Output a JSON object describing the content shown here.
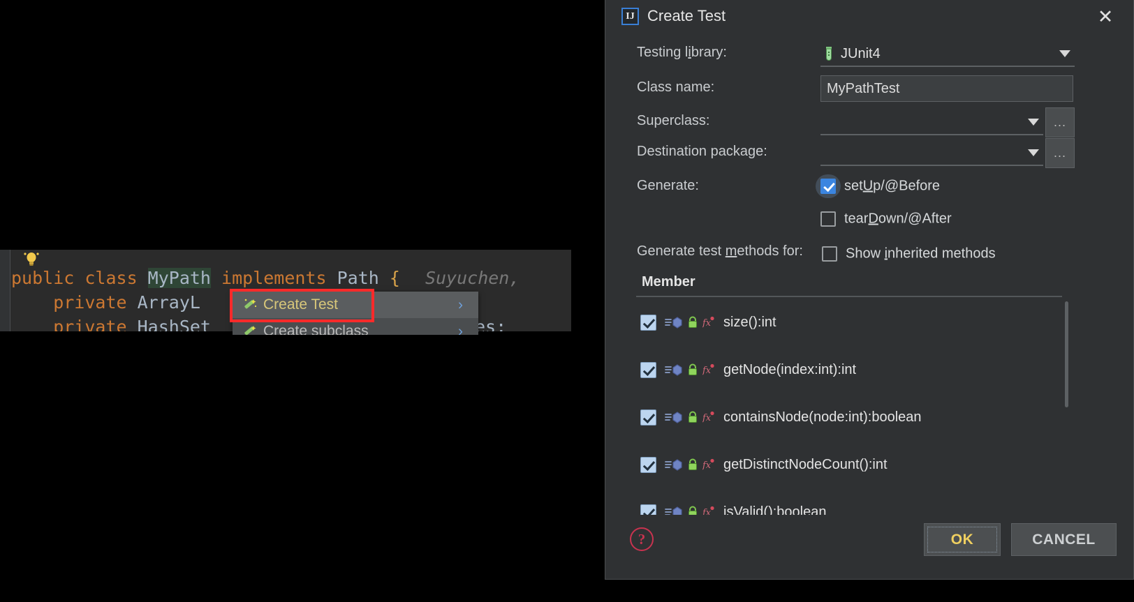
{
  "editor": {
    "code_lines": [
      {
        "segments": [
          {
            "text": "public ",
            "style": "kw"
          },
          {
            "text": "class ",
            "style": "kw"
          },
          {
            "text": "MyPath",
            "style": "clsHL"
          },
          {
            "text": " implements",
            "style": "kw"
          },
          {
            "text": " Path ",
            "style": "cls"
          },
          {
            "text": "{",
            "style": "br"
          }
        ],
        "blame": "Suyuchen,"
      },
      {
        "segments": [
          {
            "text": "    private ",
            "style": "kw"
          },
          {
            "text": "ArrayL",
            "style": "cls"
          }
        ],
        "blame": ""
      },
      {
        "segments": [
          {
            "text": "    private ",
            "style": "kw"
          },
          {
            "text": "HashSet",
            "style": "cls"
          }
        ],
        "blame": ""
      }
    ],
    "trailing_text": "es;",
    "bulb_icon": "lightbulb-icon"
  },
  "context_menu": {
    "items": [
      {
        "label": "Create Test",
        "icon": "magic-wand-icon",
        "selected": true,
        "submenu_arrow": "›"
      },
      {
        "label": "Create subclass",
        "icon": "magic-wand-icon",
        "selected": false,
        "submenu_arrow": "›"
      }
    ],
    "highlight_color": "#ff2a2a"
  },
  "dialog": {
    "app_icon": "intellij-idea-icon",
    "app_icon_text": "IJ",
    "title": "Create Test",
    "close_label": "✕",
    "fields": {
      "testing_library": {
        "label_pre": "Testing l",
        "label_mnemonic": "i",
        "label_post": "brary:",
        "value": "JUnit4",
        "icon": "test-tube-icon",
        "caret": "chevron-down-icon"
      },
      "class_name": {
        "label": "Class name:",
        "value": "MyPathTest"
      },
      "superclass": {
        "label": "Superclass:",
        "value": "",
        "browse_label": "...",
        "caret": "chevron-down-icon"
      },
      "destination_package": {
        "label": "Destination package:",
        "value": "",
        "browse_label": "...",
        "caret": "chevron-down-icon"
      }
    },
    "generate": {
      "label": "Generate:",
      "options": [
        {
          "pre": "set",
          "mnemonic": "U",
          "post": "p/@Before",
          "checked": true,
          "focused": true
        },
        {
          "pre": "tear",
          "mnemonic": "D",
          "post": "own/@After",
          "checked": false,
          "focused": false
        }
      ]
    },
    "generate_methods": {
      "label_pre": "Generate test ",
      "label_mnemonic": "m",
      "label_post": "ethods for:",
      "option": {
        "pre": "Show ",
        "mnemonic": "i",
        "post": "nherited methods",
        "checked": false
      }
    },
    "member_table": {
      "header": "Member",
      "rows": [
        {
          "checked": true,
          "text": "size():int",
          "icons": [
            "override-method-icon",
            "method-icon",
            "public-lock-icon",
            "function-fx-icon"
          ]
        },
        {
          "checked": true,
          "text": "getNode(index:int):int",
          "icons": [
            "override-method-icon",
            "method-icon",
            "public-lock-icon",
            "function-fx-icon"
          ]
        },
        {
          "checked": true,
          "text": "containsNode(node:int):boolean",
          "icons": [
            "override-method-icon",
            "method-icon",
            "public-lock-icon",
            "function-fx-icon"
          ]
        },
        {
          "checked": true,
          "text": "getDistinctNodeCount():int",
          "icons": [
            "override-method-icon",
            "method-icon",
            "public-lock-icon",
            "function-fx-icon"
          ]
        },
        {
          "checked": true,
          "text": "isValid():boolean",
          "icons": [
            "override-method-icon",
            "method-icon",
            "public-lock-icon",
            "function-fx-icon"
          ]
        }
      ]
    },
    "footer": {
      "help_icon": "help-question-icon",
      "help_glyph": "?",
      "ok_label": "OK",
      "cancel_label": "CANCEL"
    },
    "colors": {
      "accent_blue": "#3b85e0",
      "ok_text": "#f0d060",
      "help_red": "#c8334f",
      "dialog_bg": "#2f3133"
    }
  }
}
